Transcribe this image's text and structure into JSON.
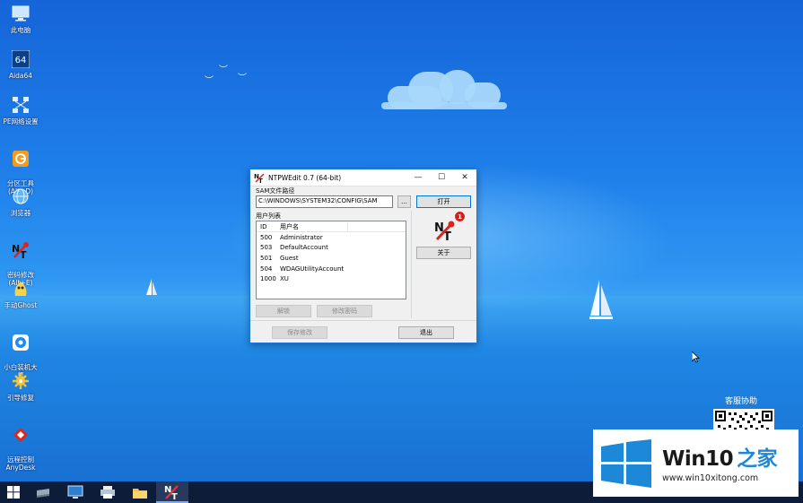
{
  "desktop": {
    "icons": [
      {
        "label": "此电脑",
        "icon": "computer-icon"
      },
      {
        "label": "Aida64",
        "icon": "aida64-icon"
      },
      {
        "label": "PE网络设置",
        "icon": "network-icon"
      },
      {
        "label": "分区工具\n(Alt+D)",
        "icon": "partition-tool-icon"
      },
      {
        "label": "浏览器",
        "icon": "browser-icon"
      },
      {
        "label": "密码修改\n(Alt+E)",
        "icon": "password-tool-icon"
      },
      {
        "label": "手动Ghost",
        "icon": "ghost-icon"
      },
      {
        "label": "小白装机大\n师",
        "icon": "installer-icon"
      },
      {
        "label": "引导修复",
        "icon": "boot-repair-icon"
      },
      {
        "label": "远程控制\nAnyDesk",
        "icon": "anydesk-icon"
      }
    ],
    "help_label": "客服协助"
  },
  "window": {
    "title": "NTPWEdit 0.7 (64-bit)",
    "minimize": "—",
    "maximize": "☐",
    "close": "✕",
    "sam_label": "SAM文件路径",
    "sam_path": "C:\\WINDOWS\\SYSTEM32\\CONFIG\\SAM",
    "browse": "...",
    "open": "打开",
    "badge": "1",
    "about": "关于",
    "users_label": "用户列表",
    "columns": [
      "ID",
      "用户名"
    ],
    "users": [
      {
        "id": "500",
        "name": "Administrator"
      },
      {
        "id": "503",
        "name": "DefaultAccount"
      },
      {
        "id": "501",
        "name": "Guest"
      },
      {
        "id": "504",
        "name": "WDAGUtilityAccount"
      },
      {
        "id": "1000",
        "name": "XU"
      }
    ],
    "unlock": "解锁",
    "change_password": "修改密码",
    "save": "保存修改",
    "exit": "退出"
  },
  "watermark": {
    "brand_prefix": "Win10",
    "brand_suffix": "之家",
    "url": "www.win10xitong.com"
  },
  "colors": {
    "accent": "#0078d7",
    "badge": "#d62020",
    "taskbar": "#0d1c38"
  }
}
